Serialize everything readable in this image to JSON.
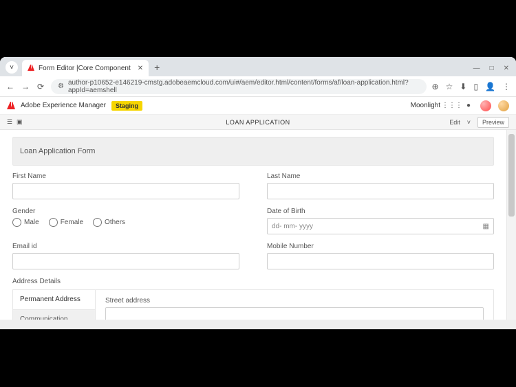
{
  "browser": {
    "tab_title": "Form Editor |Core Component",
    "url": "author-p10652-e146219-cmstg.adobeaemcloud.com/ui#/aem/editor.html/content/forms/af/loan-application.html?appId=aemshell"
  },
  "aem": {
    "product": "Adobe Experience Manager",
    "badge": "Staging",
    "profile": "Moonlight"
  },
  "pagebar": {
    "title": "LOAN APPLICATION",
    "edit": "Edit",
    "preview": "Preview"
  },
  "form": {
    "title": "Loan Application Form",
    "first_name": "First Name",
    "last_name": "Last Name",
    "gender": "Gender",
    "gender_opts": {
      "male": "Male",
      "female": "Female",
      "others": "Others"
    },
    "dob": "Date of Birth",
    "dob_placeholder": "dd- mm- yyyy",
    "email": "Email id",
    "mobile": "Mobile Number",
    "address_section": "Address Details",
    "addr_tabs": {
      "permanent": "Permanent Address",
      "communication": "Communication"
    },
    "street": "Street address"
  }
}
